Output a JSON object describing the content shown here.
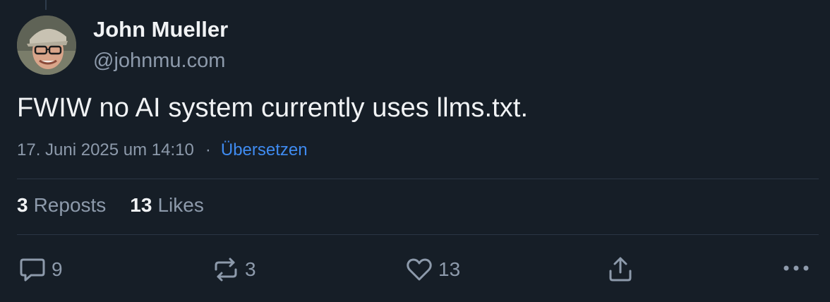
{
  "author": {
    "name": "John Mueller",
    "handle": "@johnmu.com"
  },
  "post": {
    "text": "FWIW no AI system currently uses llms.txt.",
    "timestamp": "17. Juni 2025 um 14:10",
    "separator": "·",
    "translate_label": "Übersetzen"
  },
  "stats": {
    "reposts_count": "3",
    "reposts_label": "Reposts",
    "likes_count": "13",
    "likes_label": "Likes"
  },
  "actions": {
    "reply_count": "9",
    "repost_count": "3",
    "like_count": "13",
    "share_icon": "share-icon",
    "more_icon": "more-icon"
  },
  "colors": {
    "background": "#161e27",
    "muted": "#8d9aab",
    "link": "#3f8bf0",
    "text": "#f1f3f5"
  }
}
